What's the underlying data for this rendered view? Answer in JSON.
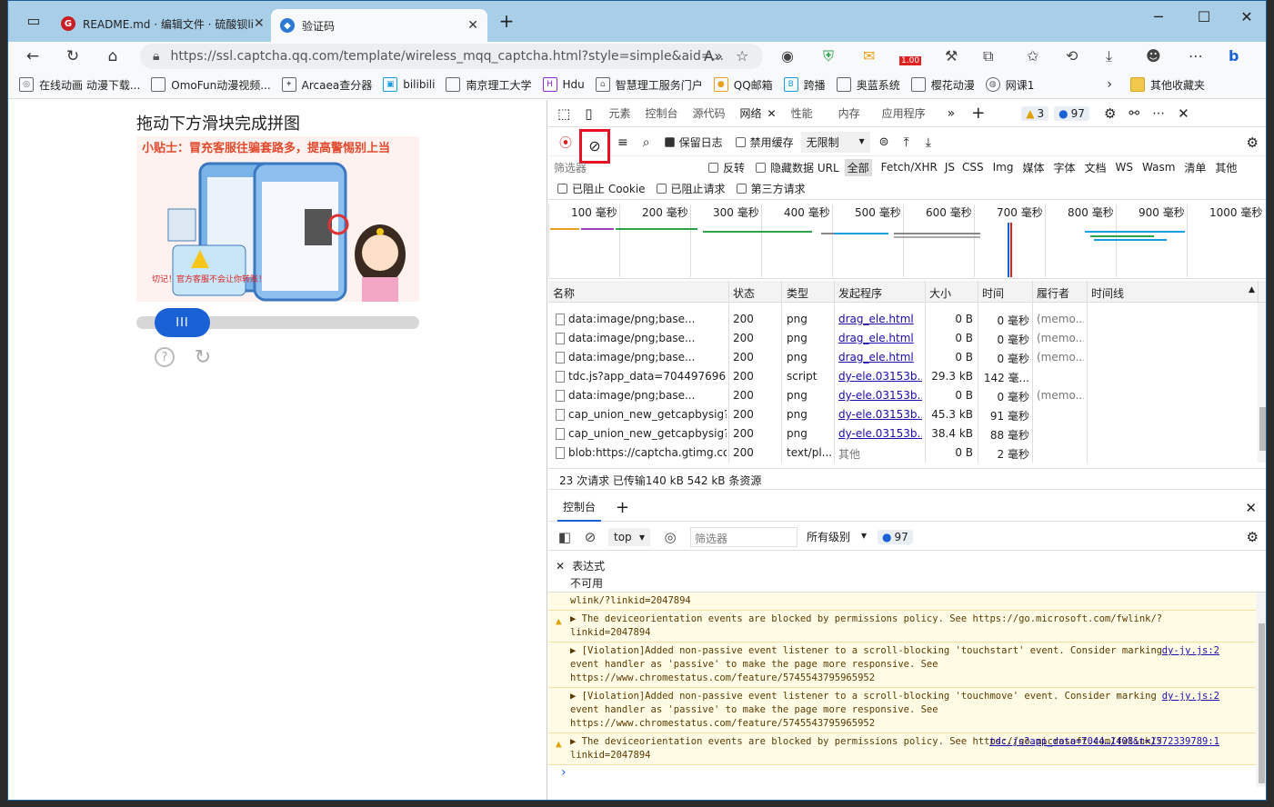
{
  "tabs": [
    {
      "title": "README.md · 编辑文件 · 硫酸钡li",
      "favicon": "G"
    },
    {
      "title": "验证码",
      "favicon": "shield"
    }
  ],
  "window": {
    "minimize": "─",
    "maximize": "☐",
    "close": "✕"
  },
  "address": {
    "url": "https://ssl.captcha.qq.com/template/wireless_mqq_captcha.html?style=simple&aid=...",
    "badge": "1.00"
  },
  "bookmarks": [
    "在线动画 动漫下载...",
    "OmoFun动漫视频...",
    "Arcaea查分器",
    "bilibili",
    "南京理工大学",
    "Hdu",
    "智慧理工服务门户",
    "QQ邮箱",
    "跨播",
    "奥蓝系统",
    "樱花动漫",
    "网课1"
  ],
  "bookmarks_other": "其他收藏夹",
  "page": {
    "title": "拖动下方滑块完成拼图",
    "tip": "小贴士：冒充客服往骗套路多，提高警惕别上当",
    "warning": "切记！官方客服不会让你转账！",
    "slider_handle": "III",
    "help_icon": "?",
    "refresh_icon": "↻"
  },
  "devtools": {
    "tabs": [
      "元素",
      "控制台",
      "源代码",
      "网络",
      "性能",
      "内存",
      "应用程序"
    ],
    "warnings": "3",
    "messages": "97",
    "net_toolbar": {
      "preserve_log": "保留日志",
      "disable_cache": "禁用缓存",
      "throttle": "无限制"
    },
    "filter": {
      "placeholder": "筛选器",
      "invert": "反转",
      "hide_data": "隐藏数据 URL",
      "types": [
        "全部",
        "Fetch/XHR",
        "JS",
        "CSS",
        "Img",
        "媒体",
        "字体",
        "文档",
        "WS",
        "Wasm",
        "清单",
        "其他"
      ]
    },
    "filter2": [
      "已阻止 Cookie",
      "已阻止请求",
      "第三方请求"
    ],
    "timeline_ticks": [
      "100 毫秒",
      "200 毫秒",
      "300 毫秒",
      "400 毫秒",
      "500 毫秒",
      "600 毫秒",
      "700 毫秒",
      "800 毫秒",
      "900 毫秒",
      "1000 毫秒"
    ],
    "columns": [
      "名称",
      "状态",
      "类型",
      "发起程序",
      "大小",
      "时间",
      "履行者",
      "时间线"
    ],
    "rows": [
      {
        "name": "data:image/png;base...",
        "status": "200",
        "type": "png",
        "initiator": "drag_ele.html",
        "size": "0 B",
        "time": "0 毫秒",
        "fulfilled": "(memo..."
      },
      {
        "name": "data:image/png;base...",
        "status": "200",
        "type": "png",
        "initiator": "drag_ele.html",
        "size": "0 B",
        "time": "0 毫秒",
        "fulfilled": "(memo..."
      },
      {
        "name": "data:image/png;base...",
        "status": "200",
        "type": "png",
        "initiator": "drag_ele.html",
        "size": "0 B",
        "time": "0 毫秒",
        "fulfilled": "(memo..."
      },
      {
        "name": "tdc.js?app_data=7044976968...",
        "status": "200",
        "type": "script",
        "initiator": "dy-ele.03153b...",
        "size": "29.3 kB",
        "time": "142 毫...",
        "fulfilled": ""
      },
      {
        "name": "data:image/png;base...",
        "status": "200",
        "type": "png",
        "initiator": "dy-ele.03153b...",
        "size": "0 B",
        "time": "0 毫秒",
        "fulfilled": "(memo..."
      },
      {
        "name": "cap_union_new_getcapbysig?i...",
        "status": "200",
        "type": "png",
        "initiator": "dy-ele.03153b...",
        "size": "45.3 kB",
        "time": "91 毫秒",
        "fulfilled": ""
      },
      {
        "name": "cap_union_new_getcapbysig?i...",
        "status": "200",
        "type": "png",
        "initiator": "dy-ele.03153b...",
        "size": "38.4 kB",
        "time": "88 毫秒",
        "fulfilled": ""
      },
      {
        "name": "blob:https://captcha.gtimg.co...",
        "status": "200",
        "type": "text/pl...",
        "initiator": "其他",
        "size": "0 B",
        "time": "2 毫秒",
        "fulfilled": ""
      }
    ],
    "summary": "23 次请求  已传输140 kB  542 kB 条资源",
    "console_tab": "控制台",
    "console_toolbar": {
      "context": "top",
      "filter_placeholder": "筛选器",
      "levels": "所有级别",
      "count": "97"
    },
    "expression": {
      "label": "表达式",
      "value": "不可用"
    },
    "console": [
      {
        "warn": false,
        "text": "wlink/?linkid=2047894",
        "source": ""
      },
      {
        "warn": true,
        "text": "▶ The deviceorientation events are blocked by permissions policy. See https://go.microsoft.com/fwlink/?linkid=2047894",
        "source": ""
      },
      {
        "warn": false,
        "text": "▶ [Violation]Added non-passive event listener to a scroll-blocking 'touchstart' event. Consider marking event handler as 'passive' to make the page more responsive. See https://www.chromestatus.com/feature/5745543795965952",
        "source": "dy-jy.js:2"
      },
      {
        "warn": false,
        "text": "▶ [Violation]Added non-passive event listener to a scroll-blocking 'touchmove' event. Consider marking event handler as 'passive' to make the page more responsive. See https://www.chromestatus.com/feature/5745543795965952",
        "source": "dy-jy.js:2"
      },
      {
        "warn": true,
        "text": "▶ The deviceorientation events are blocked by permissions policy. See https://go.microsoft.com/fwlink/?linkid=2047894",
        "source": "tdc.js?app_data=7044…1408&t=1572339789:1"
      }
    ],
    "prompt": "›"
  },
  "colors": {
    "accent": "#1a61d6",
    "highlight": "#e81123"
  }
}
